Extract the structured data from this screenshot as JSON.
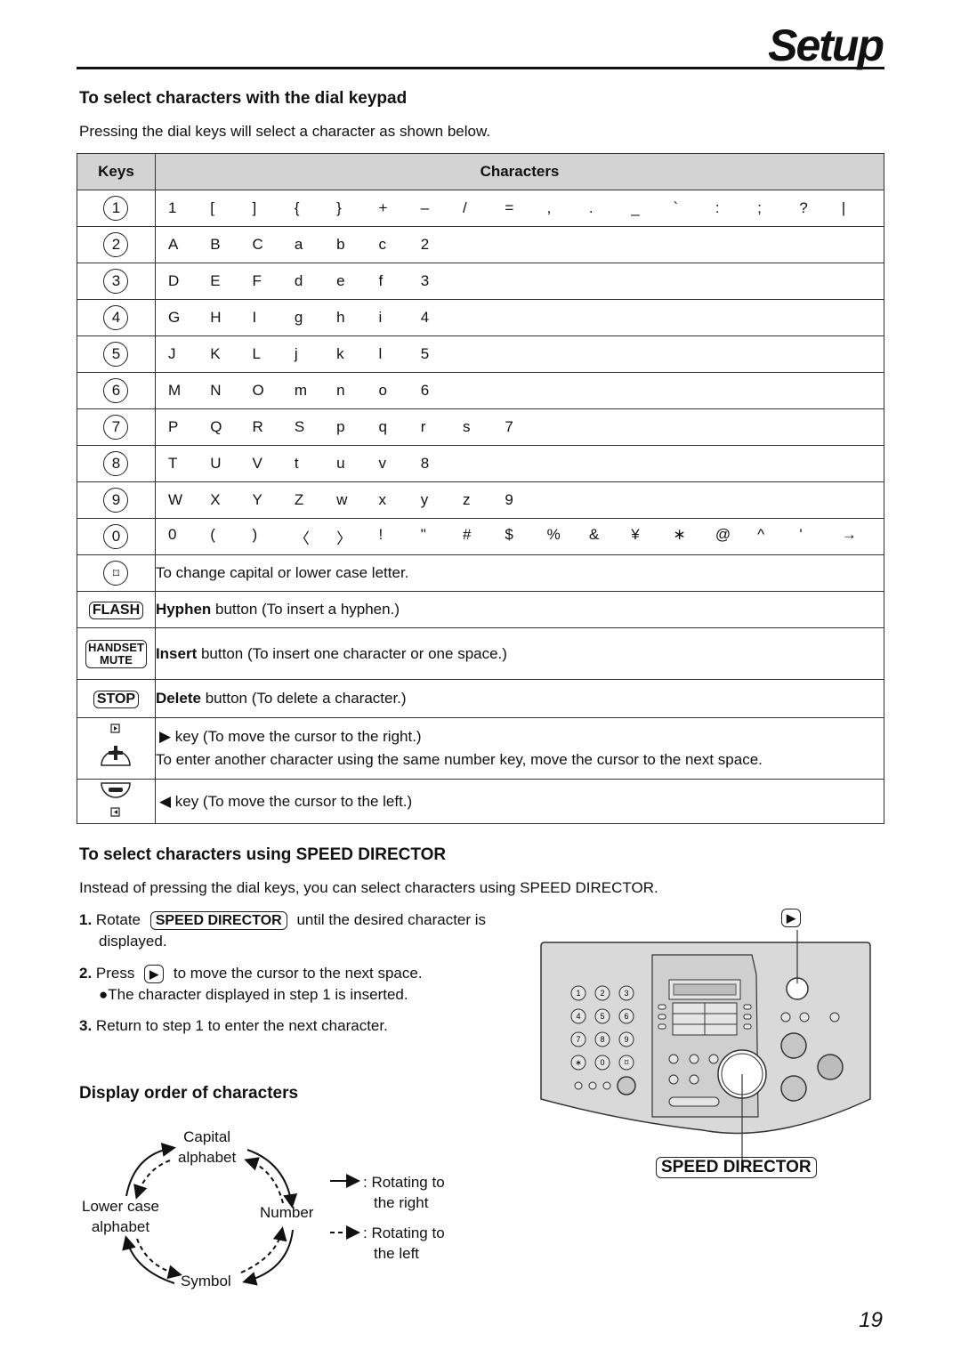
{
  "header": {
    "title": "Setup"
  },
  "section1": {
    "heading": "To select characters with the dial keypad",
    "intro": "Pressing the dial keys will select a character as shown below.",
    "table": {
      "col_keys": "Keys",
      "col_chars": "Characters",
      "char_rows": [
        {
          "key": "1",
          "chars": [
            "1",
            "[",
            "]",
            "{",
            "}",
            "+",
            "–",
            "/",
            "=",
            ",",
            ".",
            "_",
            "`",
            ":",
            ";",
            "?",
            "|"
          ]
        },
        {
          "key": "2",
          "chars": [
            "A",
            "B",
            "C",
            "a",
            "b",
            "c",
            "2"
          ]
        },
        {
          "key": "3",
          "chars": [
            "D",
            "E",
            "F",
            "d",
            "e",
            "f",
            "3"
          ]
        },
        {
          "key": "4",
          "chars": [
            "G",
            "H",
            "I",
            "g",
            "h",
            "i",
            "4"
          ]
        },
        {
          "key": "5",
          "chars": [
            "J",
            "K",
            "L",
            "j",
            "k",
            "l",
            "5"
          ]
        },
        {
          "key": "6",
          "chars": [
            "M",
            "N",
            "O",
            "m",
            "n",
            "o",
            "6"
          ]
        },
        {
          "key": "7",
          "chars": [
            "P",
            "Q",
            "R",
            "S",
            "p",
            "q",
            "r",
            "s",
            "7"
          ]
        },
        {
          "key": "8",
          "chars": [
            "T",
            "U",
            "V",
            "t",
            "u",
            "v",
            "8"
          ]
        },
        {
          "key": "9",
          "chars": [
            "W",
            "X",
            "Y",
            "Z",
            "w",
            "x",
            "y",
            "z",
            "9"
          ]
        },
        {
          "key": "0",
          "chars": [
            "0",
            "(",
            ")",
            "〈",
            "〉",
            "!",
            "\"",
            "#",
            "$",
            "%",
            "&",
            "¥",
            "∗",
            "@",
            "^",
            "'",
            "→"
          ]
        }
      ],
      "func_rows": {
        "hash": {
          "key": "⌑",
          "text": "To change capital or lower case letter."
        },
        "flash": {
          "key": "FLASH",
          "bold": "Hyphen",
          "text": " button (To insert a hyphen.)"
        },
        "handset": {
          "key1": "HANDSET",
          "key2": "MUTE",
          "bold": "Insert",
          "text": " button (To insert one character or one space.)"
        },
        "stop": {
          "key": "STOP",
          "bold": "Delete",
          "text": " button (To delete a character.)"
        },
        "right": {
          "line1": "▶ key (To move the cursor to the right.)",
          "line2": "To enter another character using the same number key, move the cursor to the next space."
        },
        "left": {
          "line1": "◀ key (To move the cursor to the left.)"
        }
      }
    }
  },
  "section2": {
    "heading": "To select characters using SPEED DIRECTOR",
    "intro": "Instead of pressing the dial keys, you can select characters using SPEED DIRECTOR.",
    "steps": {
      "s1_num": "1.",
      "s1_a": "Rotate",
      "s1_key": "SPEED DIRECTOR",
      "s1_b": "until the desired character is",
      "s1_c": "displayed.",
      "s2_num": "2.",
      "s2_a": "Press",
      "s2_key": "▶",
      "s2_b": "to move the cursor to the next space.",
      "s2_bullet": "●The character displayed in step 1 is inserted.",
      "s3_num": "3.",
      "s3_a": "Return to step 1 to enter the next character."
    },
    "device": {
      "callout_top": "▶",
      "callout_bottom": "SPEED DIRECTOR",
      "keypad": [
        "1",
        "2",
        "3",
        "4",
        "5",
        "6",
        "7",
        "8",
        "9",
        "∗",
        "0",
        "⌑"
      ]
    }
  },
  "section3": {
    "heading": "Display order of characters",
    "nodes": {
      "capital1": "Capital",
      "capital2": "alphabet",
      "number": "Number",
      "symbol": "Symbol",
      "lower1": "Lower case",
      "lower2": "alphabet"
    },
    "legend": {
      "right1": ": Rotating to",
      "right2": "the right",
      "left1": ": Rotating to",
      "left2": "the left"
    }
  },
  "footer": {
    "page_number": "19"
  }
}
